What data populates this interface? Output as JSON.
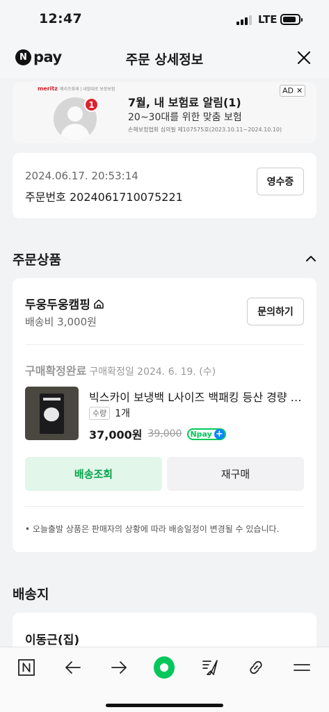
{
  "status_bar": {
    "time": "12:47",
    "network": "LTE"
  },
  "header": {
    "logo_n": "N",
    "logo_pay": "pay",
    "title": "주문 상세정보"
  },
  "ad": {
    "brand": "meritz",
    "brand_sub": "메리츠화재 | 내맘대로 보장보험",
    "badge": "1",
    "title": "7월, 내 보험료 알림(1)",
    "subtitle": "20~30대를 위한 맞춤 보험",
    "note": "손해보험협회 심의필 제107575호(2023.10.11~2024.10.10)",
    "tag": "AD",
    "tag_close": "✕"
  },
  "order": {
    "date": "2024.06.17. 20:53:14",
    "number": "주문번호 2024061710075221",
    "receipt_label": "영수증"
  },
  "products_section": {
    "title": "주문상품",
    "shop_name": "두웅두웅캠핑",
    "shipping_fee": "배송비 3,000원",
    "inquiry_label": "문의하기",
    "status": "구매확정완료",
    "status_date": "구매확정일 2024. 6. 19. (수)",
    "product_name": "빅스카이 보냉백 L사이즈 백패킹 등산 경량 …",
    "qty_tag": "수량",
    "qty": "1개",
    "price": "37,000원",
    "original_price": "39,000",
    "npay_badge": "Npay",
    "npay_plus": "+",
    "track_label": "배송조회",
    "rebuy_label": "재구매",
    "notice": "• 오늘출발 상품은 판매자의 상황에 따라 배송일정이 변경될 수 있습니다."
  },
  "shipping_section": {
    "title": "배송지",
    "recipient": "이동근(집)"
  },
  "colors": {
    "accent": "#03c75a",
    "badge_red": "#e0202c",
    "track_bg": "#e2f6ea"
  },
  "nav_icons": [
    "naver-n-icon",
    "back-arrow-icon",
    "forward-arrow-icon",
    "green-dot-icon",
    "share-icon",
    "link-icon",
    "menu-icon"
  ]
}
